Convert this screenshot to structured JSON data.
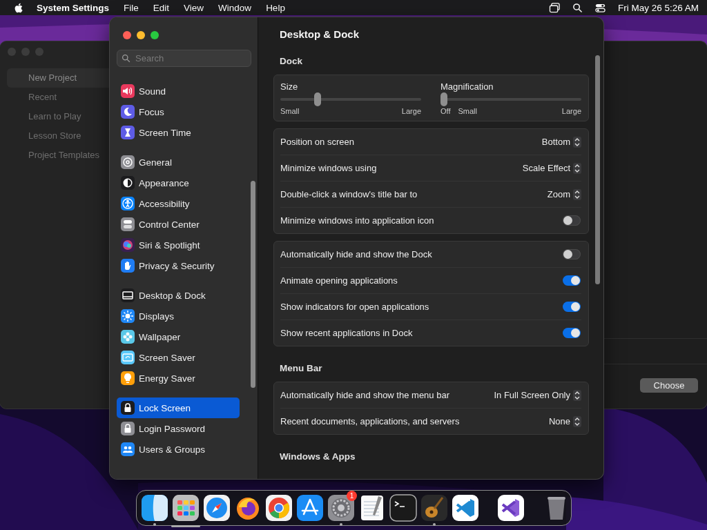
{
  "menu_bar": {
    "app_name": "System Settings",
    "menus": [
      "File",
      "Edit",
      "View",
      "Window",
      "Help"
    ],
    "clock": "Fri May 26  5:26 AM"
  },
  "background_window": {
    "sidebar": [
      {
        "label": "New Project",
        "selected": true
      },
      {
        "label": "Recent",
        "selected": false
      },
      {
        "label": "Learn to Play",
        "selected": false
      },
      {
        "label": "Lesson Store",
        "selected": false
      },
      {
        "label": "Project Templates",
        "selected": false
      }
    ],
    "choose_button": "Choose"
  },
  "settings": {
    "search": {
      "placeholder": "Search"
    },
    "sidebar_groups": [
      [
        {
          "label": "Sound",
          "kind": "sound",
          "color": "#e9395d",
          "selected": false
        },
        {
          "label": "Focus",
          "kind": "moon",
          "color": "#5e5ce6",
          "selected": false
        },
        {
          "label": "Screen Time",
          "kind": "hourglass",
          "color": "#5e5ce6",
          "selected": false
        }
      ],
      [
        {
          "label": "General",
          "kind": "gear",
          "color": "#8e8e93",
          "selected": false
        },
        {
          "label": "Appearance",
          "kind": "contrast",
          "color": "#1c1c1e",
          "selected": false
        },
        {
          "label": "Accessibility",
          "kind": "person",
          "color": "#0a84ff",
          "selected": false
        },
        {
          "label": "Control Center",
          "kind": "switches",
          "color": "#8e8e93",
          "selected": false
        },
        {
          "label": "Siri & Spotlight",
          "kind": "orb",
          "color": "#3a1f4f",
          "selected": false
        },
        {
          "label": "Privacy & Security",
          "kind": "hand",
          "color": "#1f7cf3",
          "selected": false
        }
      ],
      [
        {
          "label": "Desktop & Dock",
          "kind": "monitor",
          "color": "#1c1c1e",
          "selected": false
        },
        {
          "label": "Displays",
          "kind": "sun",
          "color": "#1f87f5",
          "selected": false
        },
        {
          "label": "Wallpaper",
          "kind": "flower",
          "color": "#5ac8e8",
          "selected": false
        },
        {
          "label": "Screen Saver",
          "kind": "screen",
          "color": "#5ac8fa",
          "selected": false
        },
        {
          "label": "Energy Saver",
          "kind": "bulb",
          "color": "#ff9f0a",
          "selected": false
        }
      ],
      [
        {
          "label": "Lock Screen",
          "kind": "lock",
          "color": "#1c1c1e",
          "selected": true
        },
        {
          "label": "Login Password",
          "kind": "lock",
          "color": "#8e8e93",
          "selected": false
        },
        {
          "label": "Users & Groups",
          "kind": "people",
          "color": "#1f87f5",
          "selected": false
        }
      ]
    ],
    "title": "Desktop & Dock",
    "sections": [
      {
        "title": "Dock",
        "cards": [
          {
            "kind": "sliders",
            "sliders": [
              {
                "label": "Size",
                "level": 0.25,
                "scale_labels": [
                  "Small",
                  "Large"
                ]
              },
              {
                "label": "Magnification",
                "level": 0,
                "scale_labels": [
                  "Off",
                  "Small",
                  "Large"
                ]
              }
            ]
          },
          {
            "kind": "rows",
            "rows": [
              {
                "kind": "popup",
                "label": "Position on screen",
                "value": "Bottom"
              },
              {
                "kind": "popup",
                "label": "Minimize windows using",
                "value": "Scale Effect"
              },
              {
                "kind": "popup",
                "label": "Double-click a window's title bar to",
                "value": "Zoom"
              },
              {
                "kind": "toggle",
                "label": "Minimize windows into application icon",
                "on": false
              }
            ]
          },
          {
            "kind": "rows",
            "rows": [
              {
                "kind": "toggle",
                "label": "Automatically hide and show the Dock",
                "on": false
              },
              {
                "kind": "toggle",
                "label": "Animate opening applications",
                "on": true
              },
              {
                "kind": "toggle",
                "label": "Show indicators for open applications",
                "on": true
              },
              {
                "kind": "toggle",
                "label": "Show recent applications in Dock",
                "on": true
              }
            ]
          }
        ]
      },
      {
        "title": "Menu Bar",
        "cards": [
          {
            "kind": "rows",
            "rows": [
              {
                "kind": "popup",
                "label": "Automatically hide and show the menu bar",
                "value": "In Full Screen Only"
              },
              {
                "kind": "popup",
                "label": "Recent documents, applications, and servers",
                "value": "None"
              }
            ]
          }
        ]
      },
      {
        "title": "Windows & Apps"
      }
    ]
  },
  "dock": [
    {
      "kind": "finder",
      "running": true
    },
    {
      "kind": "launchpad",
      "running": false,
      "level": 1
    },
    {
      "kind": "compass",
      "running": false
    },
    {
      "kind": "fox",
      "running": false
    },
    {
      "kind": "chrome",
      "running": false
    },
    {
      "kind": "appstore",
      "running": false
    },
    {
      "kind": "gear",
      "running": true,
      "badge": "1"
    },
    {
      "kind": "textedit",
      "running": false
    },
    {
      "kind": "terminal",
      "running": false
    },
    {
      "kind": "guitar",
      "running": true
    },
    {
      "kind": "vscode",
      "running": false
    },
    {
      "kind": "separator"
    },
    {
      "kind": "vstudio",
      "running": false
    },
    {
      "kind": "separator"
    },
    {
      "kind": "trash",
      "running": false
    }
  ]
}
